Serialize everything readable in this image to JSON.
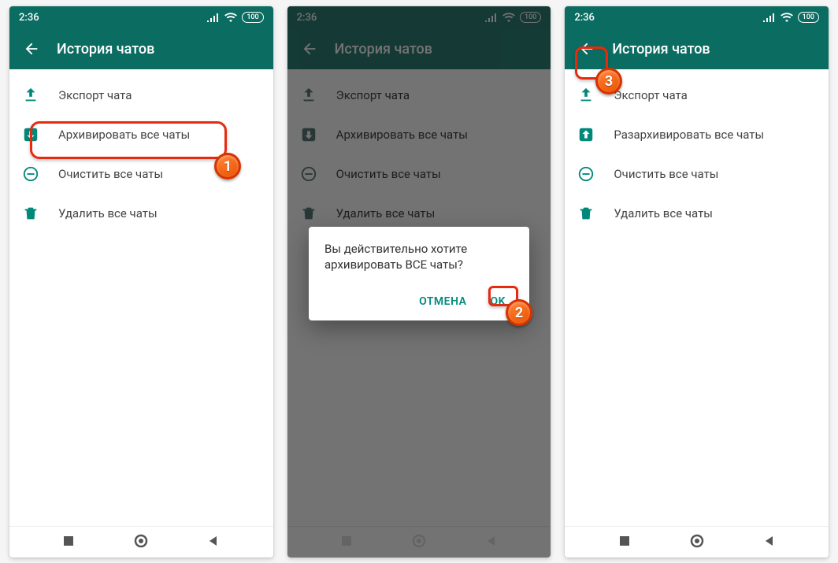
{
  "status": {
    "time": "2:36",
    "battery": "100"
  },
  "header": {
    "title": "История чатов"
  },
  "menu": {
    "export_label": "Экспорт чата",
    "archive_label": "Архивировать все чаты",
    "unarchive_label": "Разархивировать все чаты",
    "clear_label": "Очистить все чаты",
    "delete_label": "Удалить все чаты"
  },
  "dialog": {
    "message": "Вы действительно хотите архивировать ВСЕ чаты?",
    "cancel": "ОТМЕНА",
    "ok": "OK"
  },
  "steps": {
    "s1": "1",
    "s2": "2",
    "s3": "3"
  }
}
